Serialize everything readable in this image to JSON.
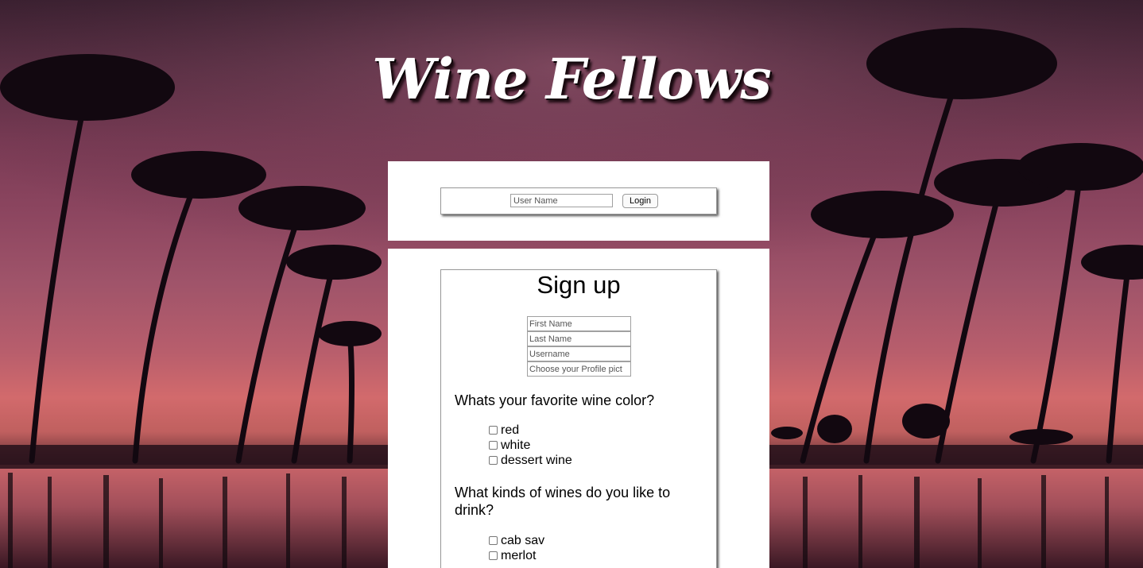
{
  "brand": {
    "title": "Wine Fellows"
  },
  "login": {
    "username_placeholder": "User Name",
    "button_label": "Login"
  },
  "signup": {
    "title": "Sign up",
    "fields": {
      "first_name_placeholder": "First Name",
      "last_name_placeholder": "Last Name",
      "username_placeholder": "Username",
      "profile_picture_placeholder": "Choose your Profile pict"
    },
    "color_question": "Whats your favorite wine color?",
    "color_options": [
      "red",
      "white",
      "dessert wine"
    ],
    "kinds_question": "What kinds of wines do you like to drink?",
    "kinds_options": [
      "cab sav",
      "merlot"
    ]
  },
  "colors": {
    "panel_background": "#ffffff",
    "title_text": "#ffffff",
    "sky_top": "#3a2030",
    "sky_horizon": "#d26a6c"
  }
}
